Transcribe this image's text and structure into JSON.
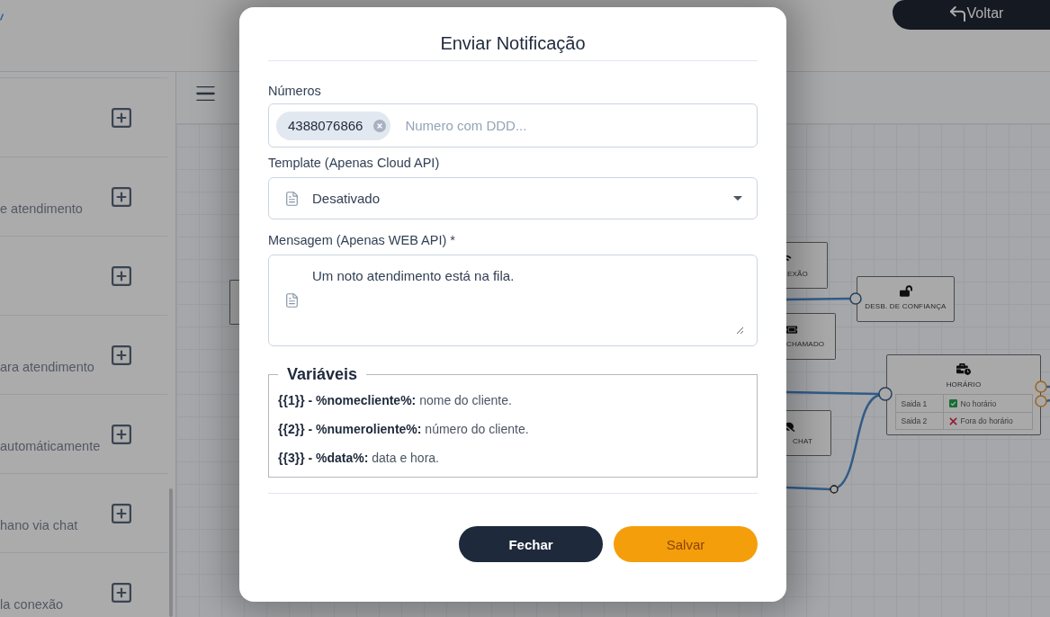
{
  "top_bar": {
    "back_button": {
      "label": "Voltar"
    }
  },
  "sidebar": {
    "items": [
      {
        "kind": "blank"
      },
      {
        "kind": "text",
        "description": "e atendimento"
      },
      {
        "kind": "blank"
      },
      {
        "kind": "text",
        "description": "ara atendimento"
      },
      {
        "kind": "text",
        "description": "automáticamente"
      },
      {
        "kind": "text",
        "description": "hano via chat"
      },
      {
        "kind": "text",
        "description": "la conexão"
      }
    ]
  },
  "flow": {
    "nodes": [
      {
        "kind": "blank"
      },
      {
        "kind": "connection",
        "label": "EXÃO"
      },
      {
        "kind": "ticket",
        "label": "CHAMADO"
      },
      {
        "kind": "chat",
        "label": "CHAT"
      },
      {
        "kind": "trust",
        "label": "DESB. DE CONFIANÇA"
      },
      {
        "kind": "schedule",
        "label": "HORÁRIO",
        "outputs": [
          {
            "name": "Saida 1",
            "condition": "No horário",
            "kind": "in_hours"
          },
          {
            "name": "Saida 2",
            "condition": "Fora do horário",
            "kind": "out_of_hours"
          }
        ]
      }
    ]
  },
  "dialog": {
    "title": "Enviar Notificação",
    "numbers": {
      "label": "Números",
      "tags": [
        "4388076866"
      ],
      "placeholder": "Numero com DDD..."
    },
    "template": {
      "label": "Template (Apenas Cloud API)",
      "value": "Desativado"
    },
    "message": {
      "label": "Mensagem (Apenas WEB API) *",
      "value": "Um noto atendimento está na fila."
    },
    "variables": {
      "title": "Variáveis",
      "items": [
        "**{{1}} - %nomecliente%:** nome do cliente.",
        "**{{2}} - %numeroliente%:** número do cliente.",
        "**{{3}} - %data%:** data e hora."
      ]
    },
    "buttons": [
      {
        "label": "Fechar",
        "kind": "secondary"
      },
      {
        "label": "Salvar",
        "kind": "primary"
      }
    ]
  }
}
